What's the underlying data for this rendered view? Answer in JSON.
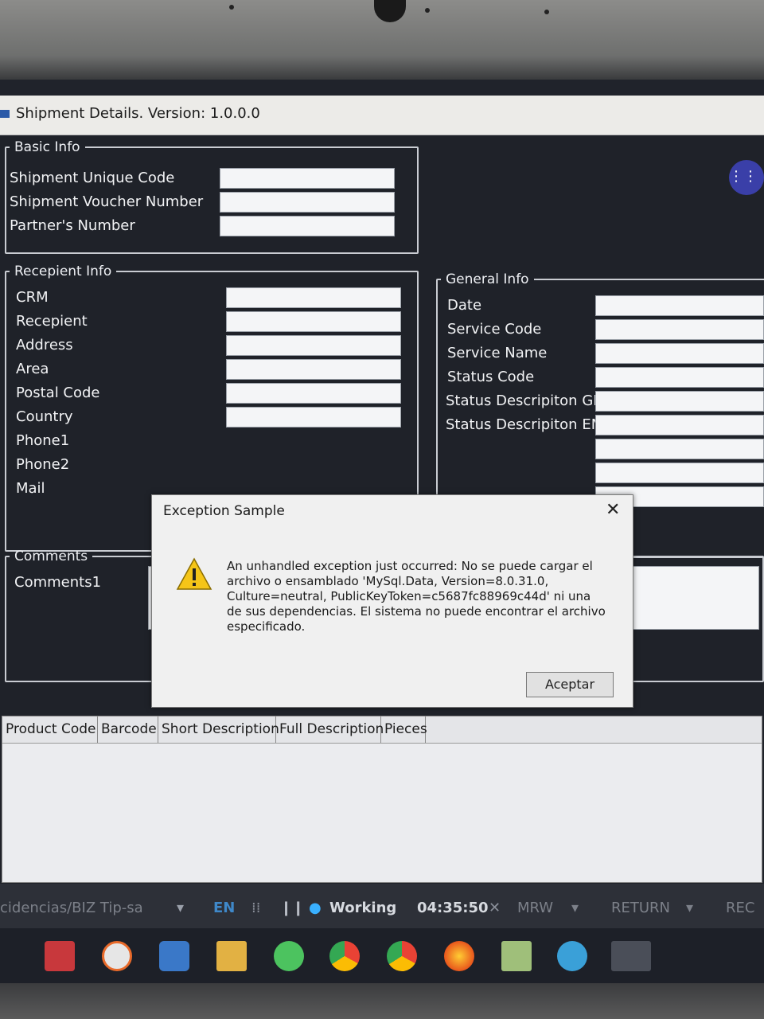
{
  "window": {
    "title": "Shipment Details. Version: 1.0.0.0"
  },
  "more_button_label": "⋮⋮⋮",
  "basic_info": {
    "legend": "Basic Info",
    "fields": [
      {
        "label": "Shipment Unique Code",
        "value": ""
      },
      {
        "label": "Shipment Voucher Number",
        "value": ""
      },
      {
        "label": "Partner's Number",
        "value": ""
      }
    ]
  },
  "recipient_info": {
    "legend": "Recepient Info",
    "fields": [
      {
        "label": "CRM",
        "value": ""
      },
      {
        "label": "Recepient",
        "value": ""
      },
      {
        "label": "Address",
        "value": ""
      },
      {
        "label": "Area",
        "value": ""
      },
      {
        "label": "Postal Code",
        "value": ""
      },
      {
        "label": "Country",
        "value": ""
      },
      {
        "label": "Phone1",
        "value": ""
      },
      {
        "label": "Phone2",
        "value": ""
      },
      {
        "label": "Mail",
        "value": ""
      }
    ]
  },
  "general_info": {
    "legend": "General Info",
    "fields": [
      {
        "label": "Date",
        "value": ""
      },
      {
        "label": "Service Code",
        "value": ""
      },
      {
        "label": "Service Name",
        "value": ""
      },
      {
        "label": "Status Code",
        "value": ""
      },
      {
        "label": "Status Descripiton GR",
        "value": ""
      },
      {
        "label": "Status Descripiton EN",
        "value": ""
      }
    ]
  },
  "comments": {
    "legend": "Comments",
    "fields": [
      {
        "label": "Comments1",
        "value": ""
      }
    ]
  },
  "grid": {
    "columns": [
      "Product Code",
      "Barcode",
      "Short Description",
      "Full Description",
      "Pieces"
    ]
  },
  "dialog": {
    "title": "Exception Sample",
    "close_glyph": "✕",
    "message": "An unhandled exception just occurred: No se puede cargar el archivo o ensamblado 'MySql.Data, Version=8.0.31.0, Culture=neutral, PublicKeyToken=c5687fc88969c44d' ni una de sus dependencias. El sistema no puede encontrar el archivo especificado.",
    "ok_label": "Aceptar",
    "icon": "warning-icon"
  },
  "toolbar": {
    "path": "cidencias/BIZ Tip-sa",
    "lang": "EN",
    "status": "Working",
    "timer": "04:35:50",
    "mrw": "MRW",
    "return": "RETURN",
    "rec": "REC"
  },
  "taskbar_icons": [
    "anydesk-icon",
    "clock-icon",
    "box-icon",
    "folder-icon",
    "whatsapp-icon",
    "chrome-icon",
    "chrome-icon",
    "firefox-icon",
    "notes-icon",
    "edge-icon",
    "app-icon"
  ],
  "colors": {
    "form_bg": "#1f2229",
    "accent": "#3a3fa8",
    "status_dot": "#39b0ff"
  }
}
